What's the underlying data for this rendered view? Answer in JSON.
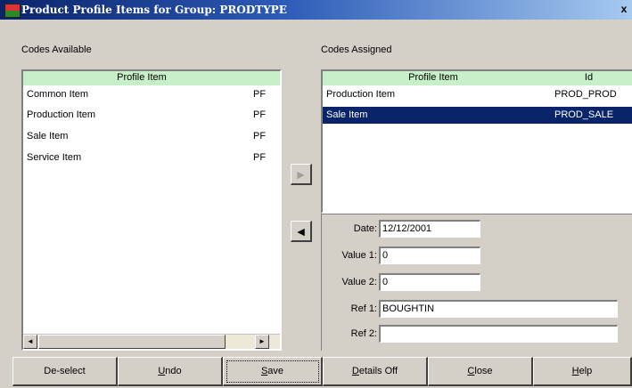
{
  "window": {
    "title": "Product Profile Items for Group: PRODTYPE",
    "close_label": "x"
  },
  "available": {
    "label": "Codes Available",
    "header": "Profile Item",
    "items": [
      {
        "name": "Common Item",
        "id": "PF"
      },
      {
        "name": "Production Item",
        "id": "PF"
      },
      {
        "name": "Sale Item",
        "id": "PF"
      },
      {
        "name": "Service Item",
        "id": "PF"
      }
    ],
    "scroll_left": "◄",
    "scroll_right": "►"
  },
  "assigned": {
    "label": "Codes Assigned",
    "header_item": "Profile Item",
    "header_id": "Id",
    "items": [
      {
        "name": "Production Item",
        "id": "PROD_PROD"
      },
      {
        "name": "Sale Item",
        "id": "PROD_SALE",
        "selected": true
      }
    ]
  },
  "move": {
    "assign_symbol": "►",
    "unassign_symbol": "◄"
  },
  "details": {
    "date_label": "Date:",
    "date_value": "12/12/2001",
    "value1_label": "Value 1:",
    "value1_value": "0",
    "value2_label": "Value 2:",
    "value2_value": "0",
    "ref1_label": "Ref 1:",
    "ref1_value": "BOUGHTIN",
    "ref2_label": "Ref 2:",
    "ref2_value": ""
  },
  "buttons": {
    "deselect": "De-select",
    "undo_key": "U",
    "undo_rest": "ndo",
    "save_key": "S",
    "save_rest": "ave",
    "details_key": "D",
    "details_rest": "etails Off",
    "close_key": "C",
    "close_rest": "lose",
    "help_key": "H",
    "help_rest": "elp"
  }
}
